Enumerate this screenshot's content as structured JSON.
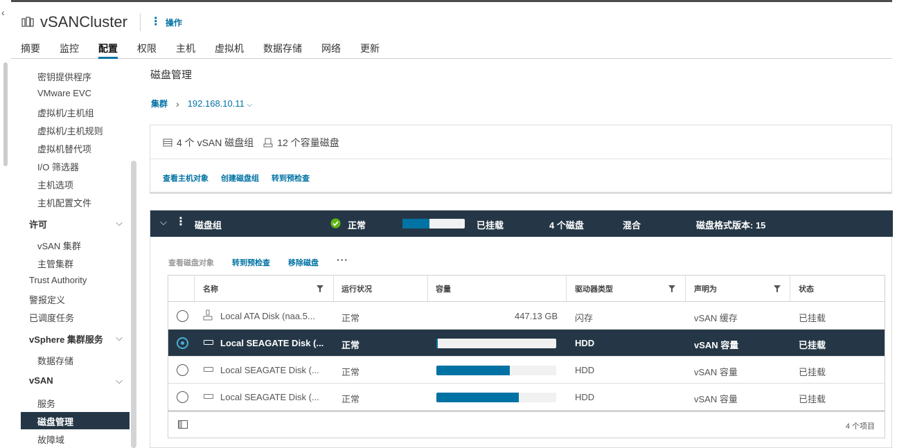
{
  "header": {
    "title": "vSANCluster",
    "actions_label": "操作",
    "tabs": [
      "摘要",
      "监控",
      "配置",
      "权限",
      "主机",
      "虚拟机",
      "数据存储",
      "网络",
      "更新"
    ],
    "active_tab": "配置"
  },
  "nav": {
    "items_top": [
      "密钥提供程序",
      "VMware EVC",
      "虚拟机/主机组",
      "虚拟机/主机规则",
      "虚拟机替代项",
      "I/O 筛选器",
      "主机选项",
      "主机配置文件"
    ],
    "group_license": "许可",
    "license_items": [
      "vSAN 集群",
      "主管集群"
    ],
    "trust_authority": "Trust Authority",
    "alarm_definitions": "警报定义",
    "scheduled_tasks": "已调度任务",
    "group_vsphere_services": "vSphere 集群服务",
    "datastores": "数据存储",
    "group_vsan": "vSAN",
    "services": "服务",
    "disk_management": "磁盘管理",
    "fault_domains": "故障域"
  },
  "main": {
    "page_title": "磁盘管理",
    "breadcrumb": {
      "root": "集群",
      "host": "192.168.10.11"
    },
    "summary": {
      "disk_groups": "4 个 vSAN 磁盘组",
      "capacity_disks": "12 个容量磁盘",
      "links": [
        "查看主机对象",
        "创建磁盘组",
        "转到预检查"
      ]
    },
    "disk_group": {
      "label": "磁盘组",
      "health": "正常",
      "usage_fraction": 0.43,
      "state": "已挂载",
      "disk_count": "4 个磁盘",
      "type": "混合",
      "format_version": "磁盘格式版本: 15",
      "toolbar": {
        "view_objects": "查看磁盘对象",
        "precheck": "转到预检查",
        "remove": "移除磁盘",
        "more": "···"
      },
      "columns": {
        "name": "名称",
        "health": "运行状况",
        "capacity": "容量",
        "drive_type": "驱动器类型",
        "claimed_as": "声明为",
        "state": "状态"
      },
      "rows": [
        {
          "name": "Local ATA Disk (naa.5...",
          "health": "正常",
          "capacity_text": "447.13 GB",
          "capacity_fill": null,
          "drive_type": "闪存",
          "claimed_as": "vSAN 缓存",
          "state": "已挂载",
          "selected": false,
          "icon": "ssd-icon"
        },
        {
          "name": "Local SEAGATE Disk (...",
          "health": "正常",
          "capacity_text": "",
          "capacity_fill": 0.01,
          "drive_type": "HDD",
          "claimed_as": "vSAN 容量",
          "state": "已挂载",
          "selected": true,
          "icon": "hdd-icon"
        },
        {
          "name": "Local SEAGATE Disk (...",
          "health": "正常",
          "capacity_text": "",
          "capacity_fill": 0.61,
          "drive_type": "HDD",
          "claimed_as": "vSAN 容量",
          "state": "已挂载",
          "selected": false,
          "icon": "hdd-icon"
        },
        {
          "name": "Local SEAGATE Disk (...",
          "health": "正常",
          "capacity_text": "",
          "capacity_fill": 0.69,
          "drive_type": "HDD",
          "claimed_as": "vSAN 容量",
          "state": "已挂载",
          "selected": false,
          "icon": "hdd-icon"
        }
      ],
      "footer_count": "4 个项目"
    }
  }
}
